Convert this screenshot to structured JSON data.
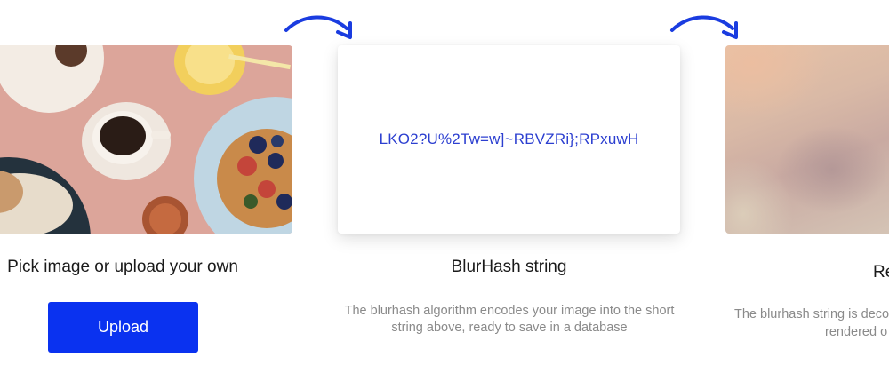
{
  "colors": {
    "accent": "#0a32f0",
    "hash_text": "#2c3fd0",
    "arrow": "#1a3ce0",
    "muted_text": "#8a8a8a"
  },
  "steps": [
    {
      "image": "breakfast-photo",
      "title": "Pick image or upload your own",
      "button_label": "Upload"
    },
    {
      "hash": "LKO2?U%2Tw=w]~RBVZRi};RPxuwH",
      "title": "BlurHash string",
      "description": "The blurhash algorithm encodes your image into the short string above, ready to save in a database"
    },
    {
      "image": "blurred-result",
      "title": "Re",
      "description_line1": "The blurhash string is deco",
      "description_line2": "rendered o"
    }
  ],
  "icons": [
    "curved-arrow-icon",
    "curved-arrow-icon"
  ]
}
